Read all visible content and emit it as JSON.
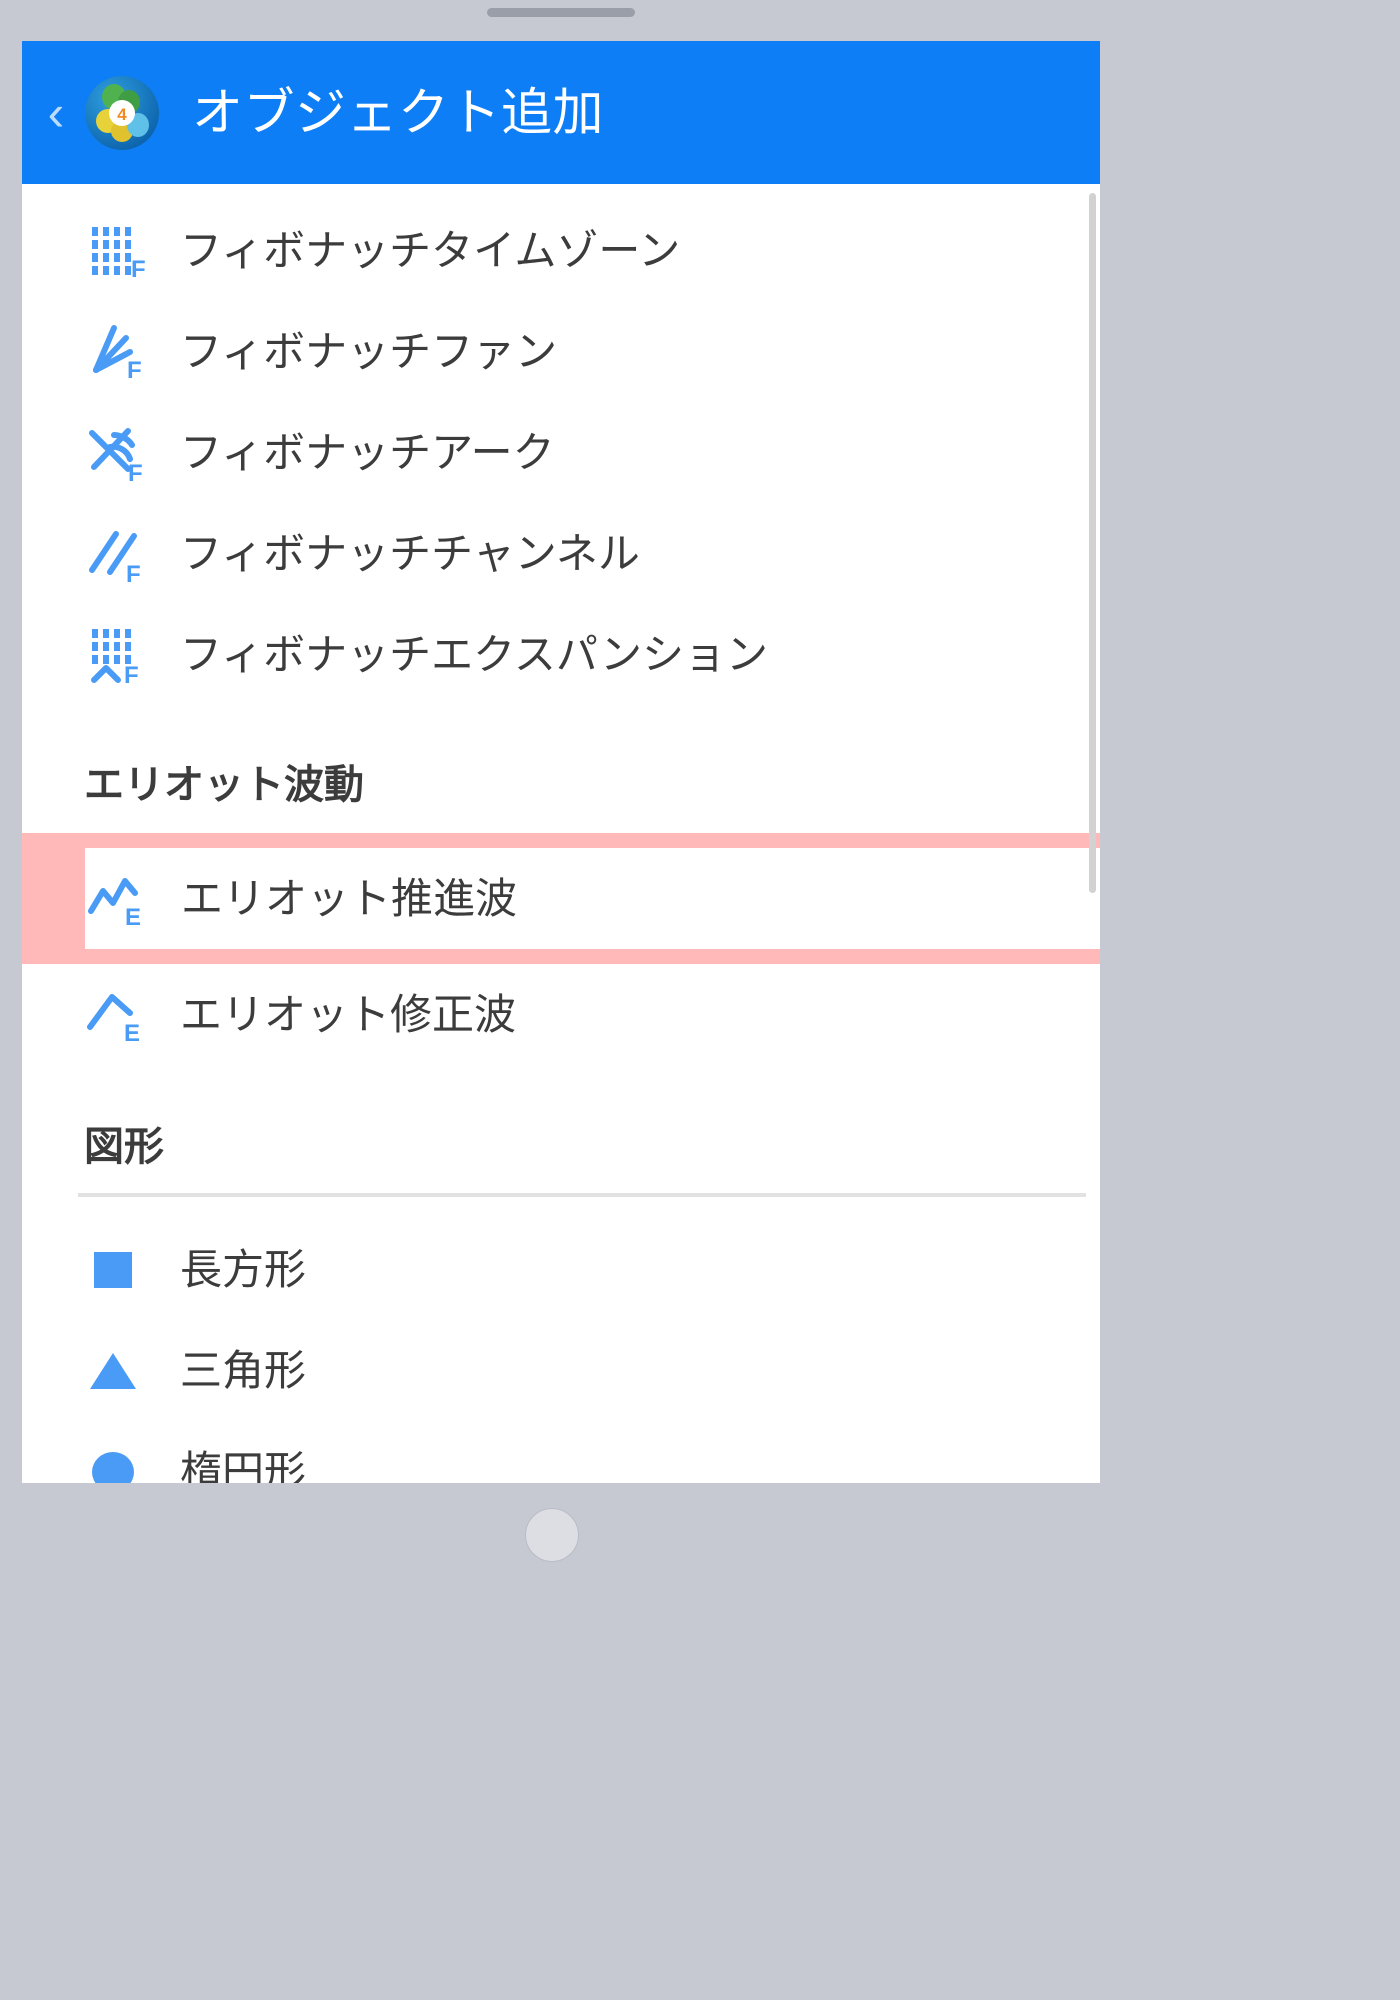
{
  "app": {
    "title": "オブジェクト追加",
    "back_label": "‹",
    "logo_badge": "4",
    "accent_color": "#0d7ef5",
    "highlight_color": "#ffb9b9",
    "icon_color": "#4a9bf5",
    "text_color": "#3c3c3c"
  },
  "list": {
    "fibonacci_items": [
      {
        "label": "フィボナッチタイムゾーン",
        "icon": "fibonacci-time-zone-icon"
      },
      {
        "label": "フィボナッチファン",
        "icon": "fibonacci-fan-icon"
      },
      {
        "label": "フィボナッチアーク",
        "icon": "fibonacci-arc-icon"
      },
      {
        "label": "フィボナッチチャンネル",
        "icon": "fibonacci-channel-icon"
      },
      {
        "label": "フィボナッチエクスパンション",
        "icon": "fibonacci-expansion-icon"
      }
    ],
    "elliott_section": {
      "header": "エリオット波動",
      "items": [
        {
          "label": "エリオット推進波",
          "icon": "elliott-impulse-wave-icon",
          "highlighted": true
        },
        {
          "label": "エリオット修正波",
          "icon": "elliott-correction-wave-icon",
          "highlighted": false
        }
      ]
    },
    "shapes_section": {
      "header": "図形",
      "items": [
        {
          "label": "長方形",
          "icon": "rectangle-icon"
        },
        {
          "label": "三角形",
          "icon": "triangle-icon"
        },
        {
          "label": "楕円形",
          "icon": "ellipse-icon"
        }
      ]
    }
  }
}
